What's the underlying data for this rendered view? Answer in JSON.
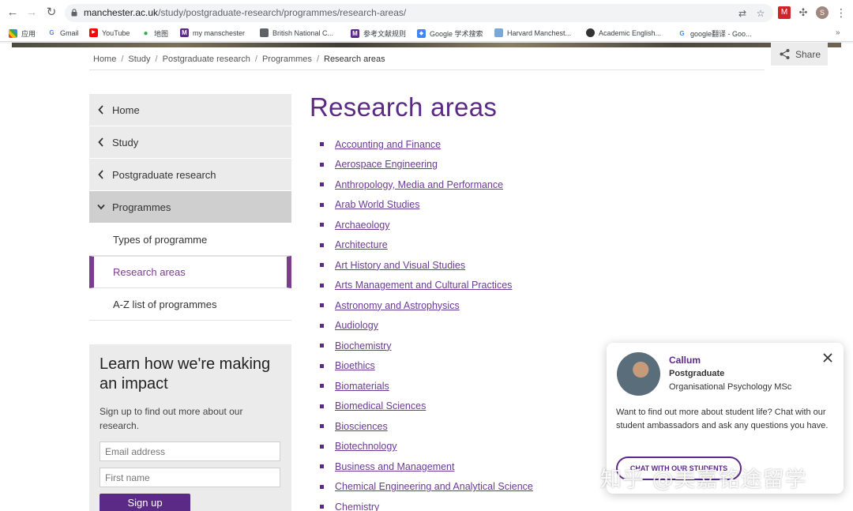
{
  "browser": {
    "url_domain": "manchester.ac.uk",
    "url_path": "/study/postgraduate-research/programmes/research-areas/",
    "avatar_initial": "S",
    "bookmarks": [
      {
        "label": "应用",
        "icon": "apps-grid-icon"
      },
      {
        "label": "Gmail",
        "icon": "google-icon"
      },
      {
        "label": "YouTube",
        "icon": "youtube-icon"
      },
      {
        "label": "地图",
        "icon": "maps-pin-icon"
      },
      {
        "label": "my manschester",
        "icon": "manchester-m-icon"
      },
      {
        "label": "British National C...",
        "icon": "document-icon"
      },
      {
        "label": "参考文献规则",
        "icon": "manchester-m-icon"
      },
      {
        "label": "Google 学术搜索",
        "icon": "scholar-icon"
      },
      {
        "label": "Harvard Manchest...",
        "icon": "cloud-icon"
      },
      {
        "label": "Academic English...",
        "icon": "globe-icon"
      },
      {
        "label": "google翻译 - Goo...",
        "icon": "google-icon"
      }
    ],
    "more_bookmarks": "»"
  },
  "share": {
    "label": "Share"
  },
  "breadcrumb": [
    "Home",
    "Study",
    "Postgraduate research",
    "Programmes",
    "Research areas"
  ],
  "sidebar": {
    "items": [
      {
        "label": "Home"
      },
      {
        "label": "Study"
      },
      {
        "label": "Postgraduate research"
      },
      {
        "label": "Programmes"
      }
    ],
    "subitems": [
      {
        "label": "Types of programme"
      },
      {
        "label": "Research areas"
      },
      {
        "label": "A-Z list of programmes"
      }
    ]
  },
  "impact": {
    "heading": "Learn how we're making an impact",
    "text": "Sign up to find out more about our research.",
    "email_placeholder": "Email address",
    "firstname_placeholder": "First name",
    "signup_label": "Sign up"
  },
  "main": {
    "title": "Research areas",
    "areas": [
      "Accounting and Finance",
      "Aerospace Engineering",
      "Anthropology, Media and Performance",
      "Arab World Studies",
      "Archaeology",
      "Architecture",
      "Art History and Visual Studies",
      "Arts Management and Cultural Practices",
      "Astronomy and Astrophysics",
      "Audiology",
      "Biochemistry",
      "Bioethics",
      "Biomaterials",
      "Biomedical Sciences",
      "Biosciences",
      "Biotechnology",
      "Business and Management",
      "Chemical Engineering and Analytical Science",
      "Chemistry"
    ]
  },
  "chat": {
    "name": "Callum",
    "role": "Postgraduate",
    "course": "Organisational Psychology MSc",
    "message": "Want to find out more about student life? Chat with our student ambassadors and ask any questions you have.",
    "cta_label": "CHAT WITH OUR STUDENTS"
  },
  "watermark": "知乎 @美嘉铭途留学",
  "colors": {
    "brand_purple": "#5b2a86",
    "link_purple": "#6b3a96",
    "active_bar": "#7a3d8f"
  }
}
